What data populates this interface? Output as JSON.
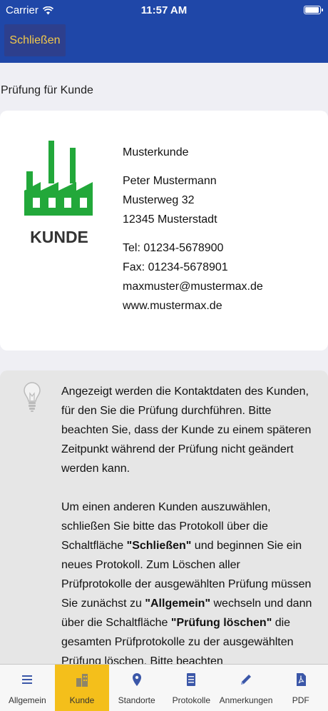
{
  "status": {
    "carrier": "Carrier",
    "time": "11:57 AM"
  },
  "nav": {
    "close_label": "Schließen"
  },
  "section_title": "Prüfung für Kunde",
  "customer": {
    "logo_text": "KUNDE",
    "name": "Musterkunde",
    "contact_person": "Peter Mustermann",
    "street": "Musterweg 32",
    "city": "12345 Musterstadt",
    "phone": "Tel: 01234-5678900",
    "fax": "Fax: 01234-5678901",
    "email": "maxmuster@mustermax.de",
    "website": "www.mustermax.de"
  },
  "hint": {
    "paragraph1": "Angezeigt werden die Kontaktdaten des Kunden, für den Sie die Prüfung durchführen. Bitte beachten Sie, dass der Kunde zu einem späteren Zeitpunkt während der Prüfung nicht geändert werden kann.",
    "p2_a": "Um einen anderen Kunden auszuwählen, schließen Sie bitte das Protokoll über die Schaltfläche ",
    "p2_b": "\"Schließen\"",
    "p2_c": " und beginnen Sie ein neues Protokoll. Zum Löschen aller Prüfprotokolle der ausgewählten Prüfung müssen Sie zunächst zu ",
    "p2_d": "\"Allgemein\"",
    "p2_e": " wechseln und dann über die Schaltfläche ",
    "p2_f": "\"Prüfung löschen\"",
    "p2_g": " die gesamten Prüfprotokolle zu der ausgewählten Prüfung löschen. Bitte beachten"
  },
  "tabs": [
    {
      "label": "Allgemein",
      "icon": "list-icon"
    },
    {
      "label": "Kunde",
      "icon": "building-icon",
      "active": true
    },
    {
      "label": "Standorte",
      "icon": "location-pin-icon"
    },
    {
      "label": "Protokolle",
      "icon": "document-icon"
    },
    {
      "label": "Anmerkungen",
      "icon": "pencil-icon"
    },
    {
      "label": "PDF",
      "icon": "pdf-icon"
    }
  ],
  "colors": {
    "header": "#1f47a8",
    "close_text": "#f3c94a",
    "active_tab": "#f4bf1b",
    "logo_green": "#22a83a"
  }
}
